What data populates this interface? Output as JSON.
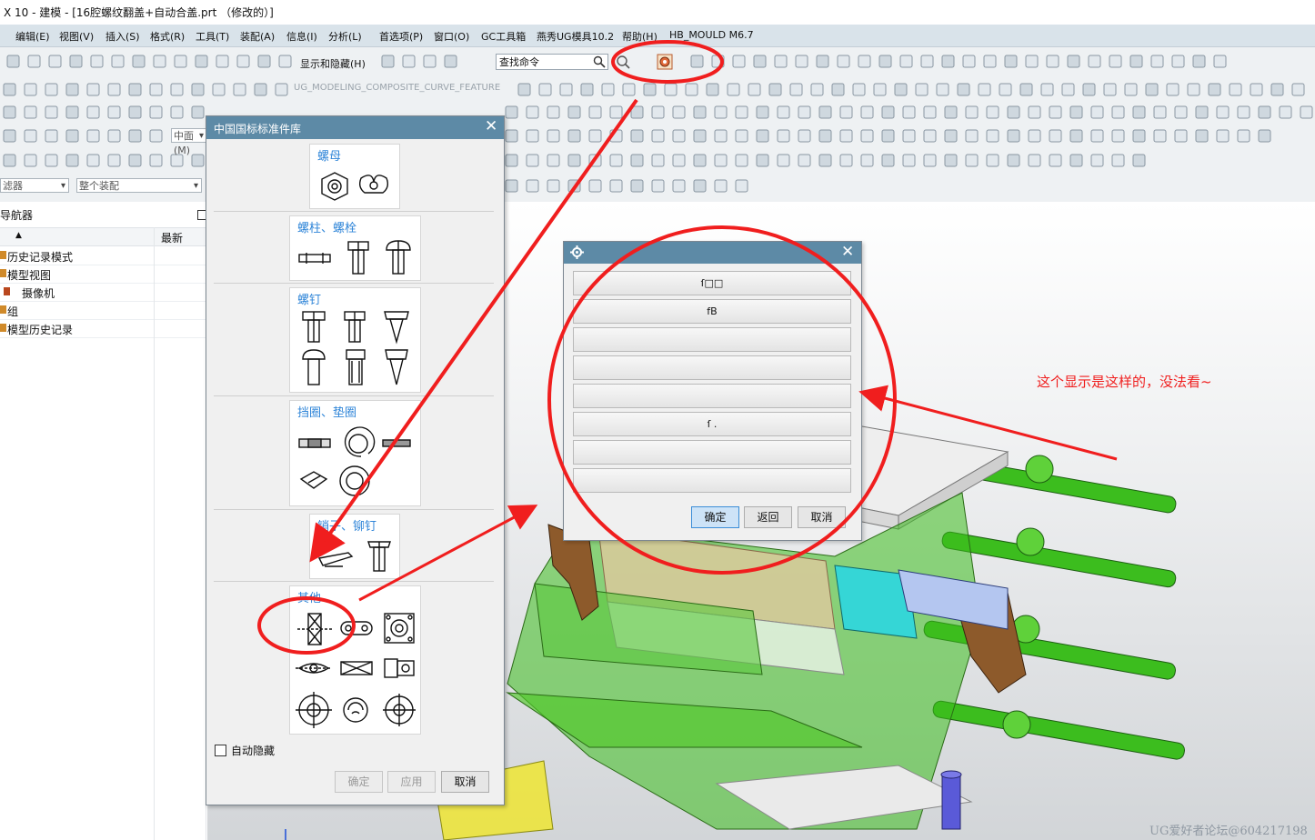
{
  "window": {
    "title": "X 10 - 建模 - [16腔螺纹翻盖+自动合盖.prt （修改的）]"
  },
  "menu": [
    "编辑(E)",
    "视图(V)",
    "插入(S)",
    "格式(R)",
    "工具(T)",
    "装配(A)",
    "信息(I)",
    "分析(L)",
    "首选项(P)",
    "窗口(O)",
    "GC工具箱",
    "燕秀UG模具10.2",
    "帮助(H)",
    "HB_MOULD M6.7"
  ],
  "toolbar": {
    "show_hide_label": "显示和隐藏(H)",
    "search_placeholder": "查找命令",
    "composite_curve_label": "UG_MODELING_COMPOSITE_CURVE_FEATURE",
    "snap_label": "中面(M)",
    "filter_label": "滤器",
    "assembly_label": "整个装配"
  },
  "navigator": {
    "title": "导航器",
    "column_recent": "最新",
    "items": [
      "历史记录模式",
      "模型视图",
      "摄像机",
      "组",
      "模型历史记录"
    ]
  },
  "standard_parts_dialog": {
    "title": "中国国标标准件库",
    "categories": [
      "螺母",
      "螺柱、螺栓",
      "螺钉",
      "挡圈、垫圈",
      "销子、铆钉",
      "其他"
    ],
    "auto_hide_label": "自动隐藏",
    "ok_label": "确定",
    "apply_label": "应用",
    "cancel_label": "取消"
  },
  "option_dialog": {
    "options": [
      "ſ□□",
      "fB",
      "",
      "",
      "",
      "ſ .",
      "",
      ""
    ],
    "ok_label": "确定",
    "back_label": "返回",
    "cancel_label": "取消"
  },
  "annotation": "这个显示是这样的，没法看~",
  "watermark": "UG爱好者论坛@604217198",
  "colors": {
    "annotation_red": "#f01e1e",
    "dialog_title_bar": "#5d8aa6",
    "category_blue": "#2f85d8"
  }
}
